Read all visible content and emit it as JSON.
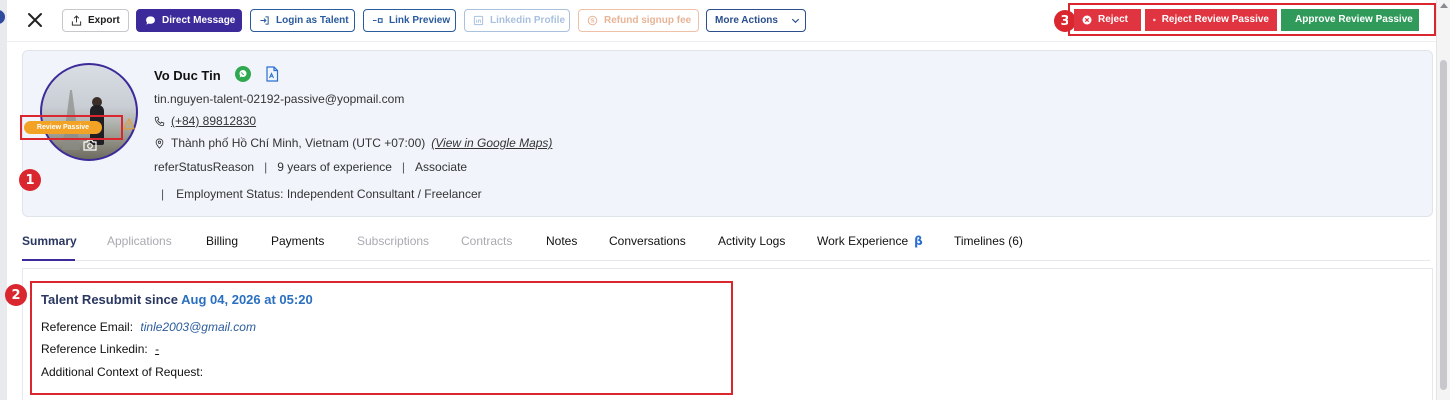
{
  "toolbar": {
    "export": "Export",
    "direct_message": "Direct Message",
    "login_as_talent": "Login as Talent",
    "link_preview": "Link Preview",
    "linkedin_profile": "Linkedin Profile",
    "refund_signup_fee": "Refund signup fee",
    "more_actions": "More Actions",
    "reject": "Reject",
    "reject_review_passive": "Reject Review Passive",
    "approve_review_passive": "Approve Review Passive"
  },
  "annotations": {
    "badge1": "1",
    "badge2": "2",
    "badge3": "3"
  },
  "profile": {
    "name": "Vo Duc Tin",
    "email": "tin.nguyen-talent-02192-passive@yopmail.com",
    "phone": "(+84) 89812830",
    "location": "Thành phố Hồ Chí Minh, Vietnam (UTC +07:00)",
    "maps_link": "(View in Google Maps)",
    "refer_status": "referStatusReason",
    "experience": "9 years of experience",
    "level": "Associate",
    "employment": "Employment Status: Independent Consultant / Freelancer",
    "status_badge": "Review Passive"
  },
  "tabs": [
    {
      "label": "Summary",
      "state": "active"
    },
    {
      "label": "Applications",
      "state": "disabled"
    },
    {
      "label": "Billing",
      "state": "normal"
    },
    {
      "label": "Payments",
      "state": "normal"
    },
    {
      "label": "Subscriptions",
      "state": "disabled"
    },
    {
      "label": "Contracts",
      "state": "disabled"
    },
    {
      "label": "Notes",
      "state": "normal"
    },
    {
      "label": "Conversations",
      "state": "normal"
    },
    {
      "label": "Activity Logs",
      "state": "normal"
    },
    {
      "label": "Work Experience",
      "state": "normal",
      "suffix": "β"
    },
    {
      "label": "Timelines (6)",
      "state": "normal"
    }
  ],
  "resubmit": {
    "title_prefix": "Talent Resubmit since",
    "date": "Aug 04, 2026 at 05:20",
    "ref_email_label": "Reference Email:",
    "ref_email": "tinle2003@gmail.com",
    "ref_linkedin_label": "Reference Linkedin:",
    "ref_linkedin": "-",
    "additional_context_label": "Additional Context of Request:"
  },
  "colors": {
    "primary_purple": "#3d2a9a",
    "link_blue": "#2a5b9c",
    "reject_red": "#e03440",
    "approve_green": "#2f9a5a",
    "status_orange": "#f2a326",
    "annotation_red": "#d9262f"
  }
}
